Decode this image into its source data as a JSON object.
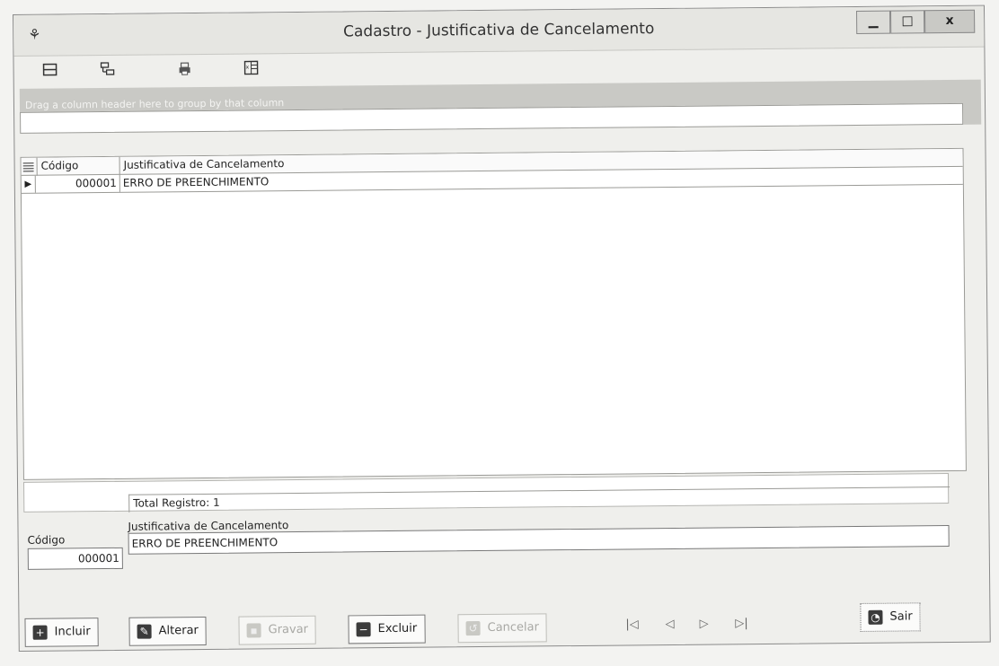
{
  "window": {
    "title": "Cadastro - Justificativa de Cancelamento",
    "controls": {
      "minimize": "▁",
      "maximize": "□",
      "close": "x"
    }
  },
  "toolbar": {
    "icons": [
      "expand-icon",
      "tree-icon",
      "print-icon",
      "excel-icon"
    ]
  },
  "grid": {
    "group_hint": "Drag a column header here to group by that column",
    "columns": [
      "Código",
      "Justificativa de Cancelamento"
    ],
    "rows": [
      {
        "codigo": "000001",
        "justificativa": "ERRO DE PREENCHIMENTO"
      }
    ],
    "total_label": "Total Registro: 1"
  },
  "form": {
    "codigo_label": "Código",
    "justificativa_label": "Justificativa de Cancelamento",
    "codigo_value": "000001",
    "justificativa_value": "ERRO DE PREENCHIMENTO"
  },
  "buttons": {
    "incluir": "Incluir",
    "alterar": "Alterar",
    "gravar": "Gravar",
    "excluir": "Excluir",
    "cancelar": "Cancelar",
    "sair": "Sair"
  },
  "nav": {
    "first": "|◁",
    "prev": "◁",
    "next": "▷",
    "last": "▷|"
  }
}
